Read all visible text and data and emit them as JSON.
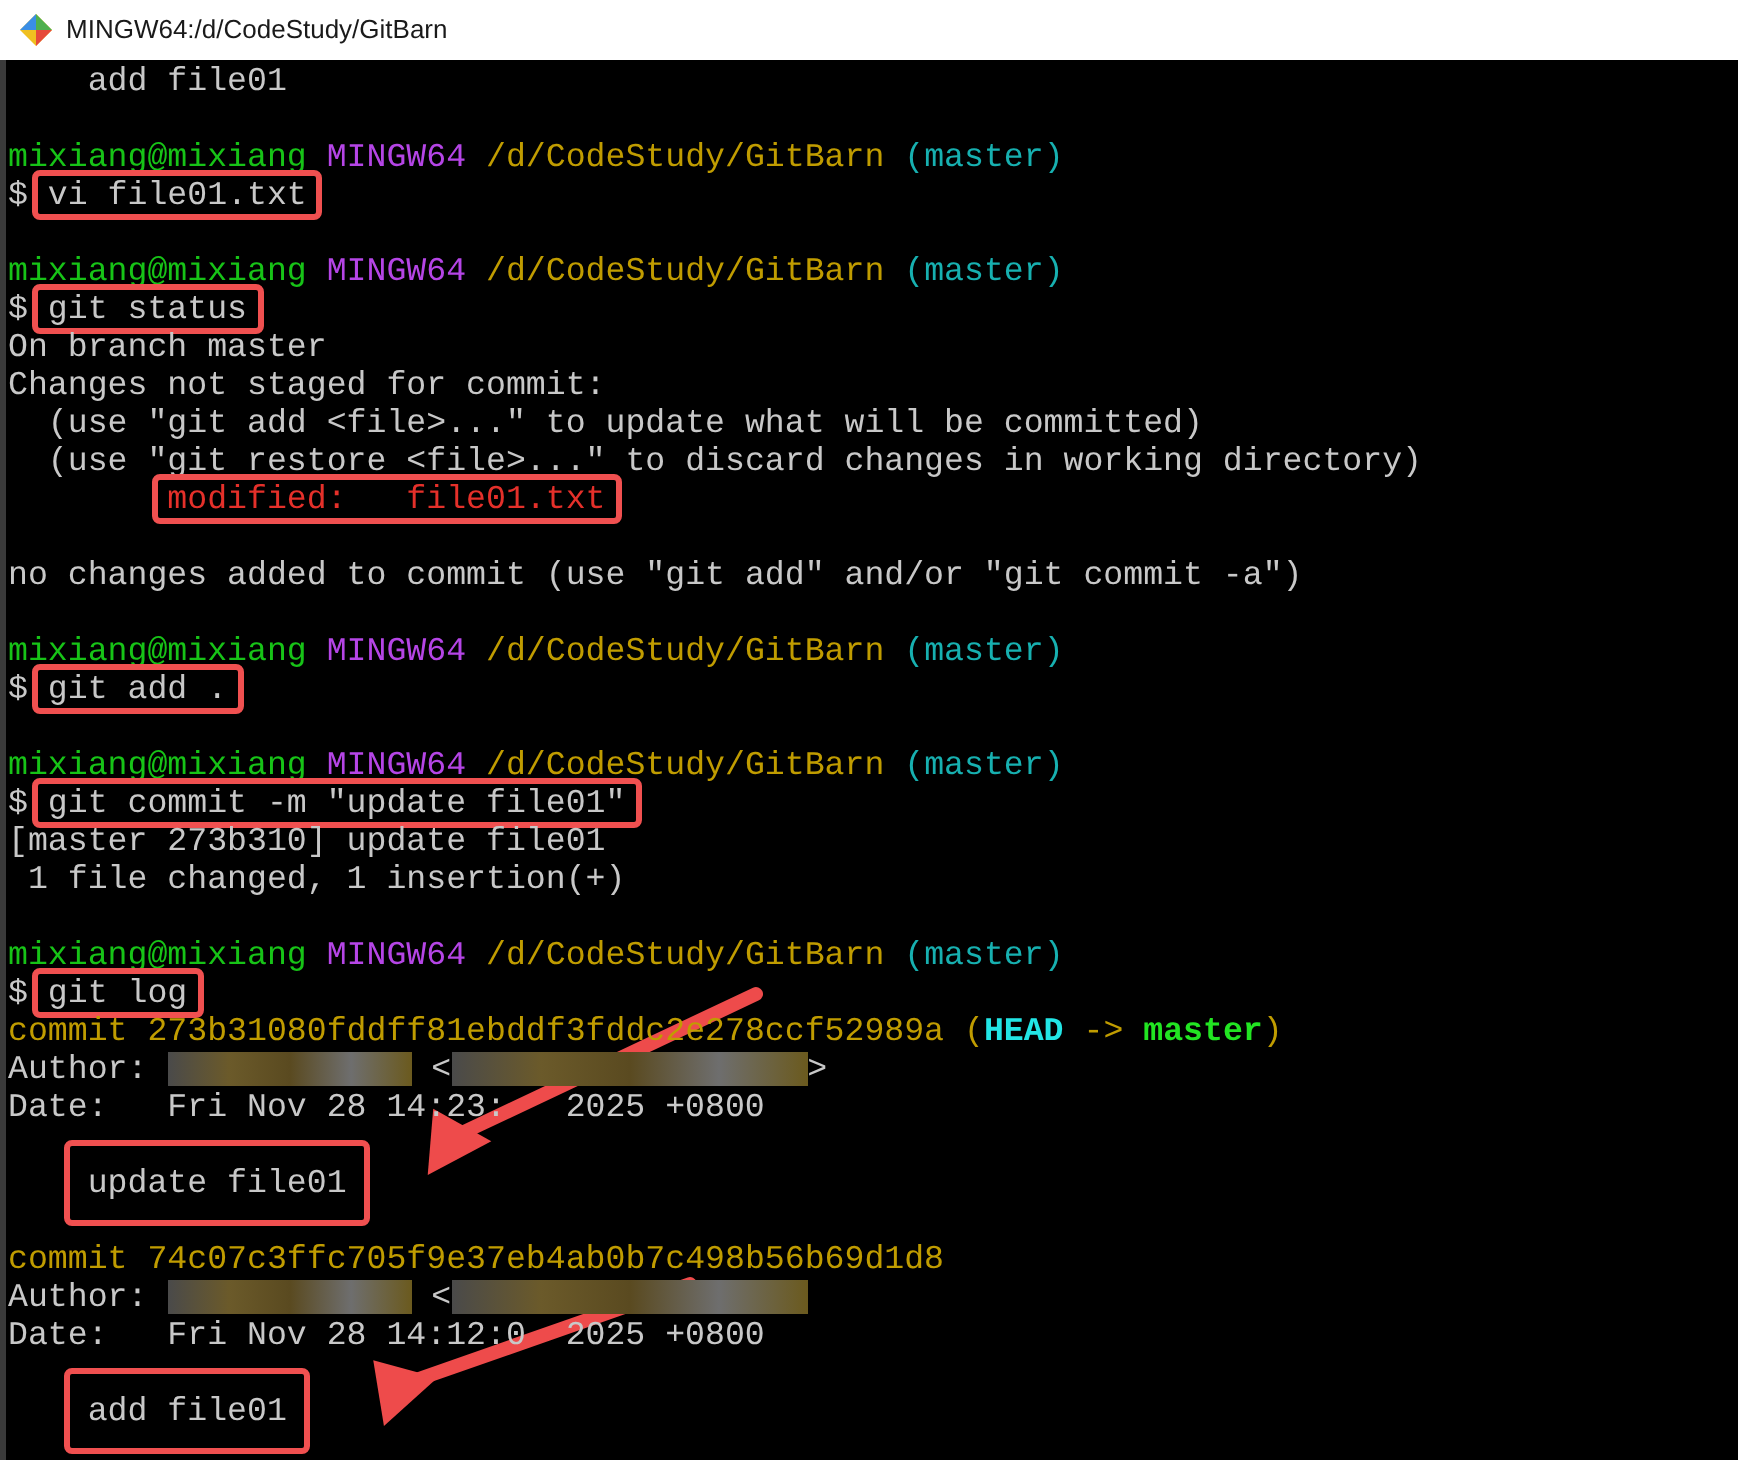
{
  "window": {
    "title": "MINGW64:/d/CodeStudy/GitBarn"
  },
  "lines": [
    {
      "kind": "output",
      "text": "    add file01"
    },
    {
      "kind": "blank"
    },
    {
      "kind": "prompt",
      "user": "mixiang@mixiang",
      "host": "MINGW64",
      "path": "/d/CodeStudy/GitBarn",
      "branch": "(master)"
    },
    {
      "kind": "command",
      "prompt": "$",
      "text": "vi file01.txt"
    },
    {
      "kind": "blank"
    },
    {
      "kind": "prompt",
      "user": "mixiang@mixiang",
      "host": "MINGW64",
      "path": "/d/CodeStudy/GitBarn",
      "branch": "(master)"
    },
    {
      "kind": "command",
      "prompt": "$",
      "text": "git status"
    },
    {
      "kind": "output",
      "text": "On branch master"
    },
    {
      "kind": "output",
      "text": "Changes not staged for commit:"
    },
    {
      "kind": "output",
      "text": "  (use \"git add <file>...\" to update what will be committed)"
    },
    {
      "kind": "output",
      "text": "  (use \"git restore <file>...\" to discard changes in working directory)"
    },
    {
      "kind": "modified",
      "text": "modified:   file01.txt"
    },
    {
      "kind": "blank"
    },
    {
      "kind": "output",
      "text": "no changes added to commit (use \"git add\" and/or \"git commit -a\")"
    },
    {
      "kind": "blank"
    },
    {
      "kind": "prompt",
      "user": "mixiang@mixiang",
      "host": "MINGW64",
      "path": "/d/CodeStudy/GitBarn",
      "branch": "(master)"
    },
    {
      "kind": "command",
      "prompt": "$",
      "text": "git add ."
    },
    {
      "kind": "blank"
    },
    {
      "kind": "prompt",
      "user": "mixiang@mixiang",
      "host": "MINGW64",
      "path": "/d/CodeStudy/GitBarn",
      "branch": "(master)"
    },
    {
      "kind": "command",
      "prompt": "$",
      "text": "git commit -m \"update file01\""
    },
    {
      "kind": "output",
      "text": "[master 273b310] update file01"
    },
    {
      "kind": "output",
      "text": " 1 file changed, 1 insertion(+)"
    },
    {
      "kind": "blank"
    },
    {
      "kind": "prompt",
      "user": "mixiang@mixiang",
      "host": "MINGW64",
      "path": "/d/CodeStudy/GitBarn",
      "branch": "(master)"
    },
    {
      "kind": "command",
      "prompt": "$",
      "text": "git log"
    },
    {
      "kind": "commit",
      "text": "commit 273b31080fddff81ebddf3fddc2e278ccf52989a (",
      "head": "HEAD",
      "arrow": " -> ",
      "branch": "master",
      "close": ")"
    },
    {
      "kind": "author",
      "label": "Author:",
      "open": "<",
      "close": ">"
    },
    {
      "kind": "date",
      "before": "Date:   Fri Nov 28 14:23:",
      "after": "2025 +0800"
    },
    {
      "kind": "blank"
    },
    {
      "kind": "message",
      "text": "update file01"
    },
    {
      "kind": "blank"
    },
    {
      "kind": "commit",
      "text": "commit 74c07c3ffc705f9e37eb4ab0b7c498b56b69d1d8"
    },
    {
      "kind": "author",
      "label": "Author:",
      "open": "<"
    },
    {
      "kind": "date",
      "before": "Date:   Fri Nov 28 14:12:0",
      "after": "2025 +0800"
    },
    {
      "kind": "blank"
    },
    {
      "kind": "message",
      "text": "add file01"
    }
  ]
}
